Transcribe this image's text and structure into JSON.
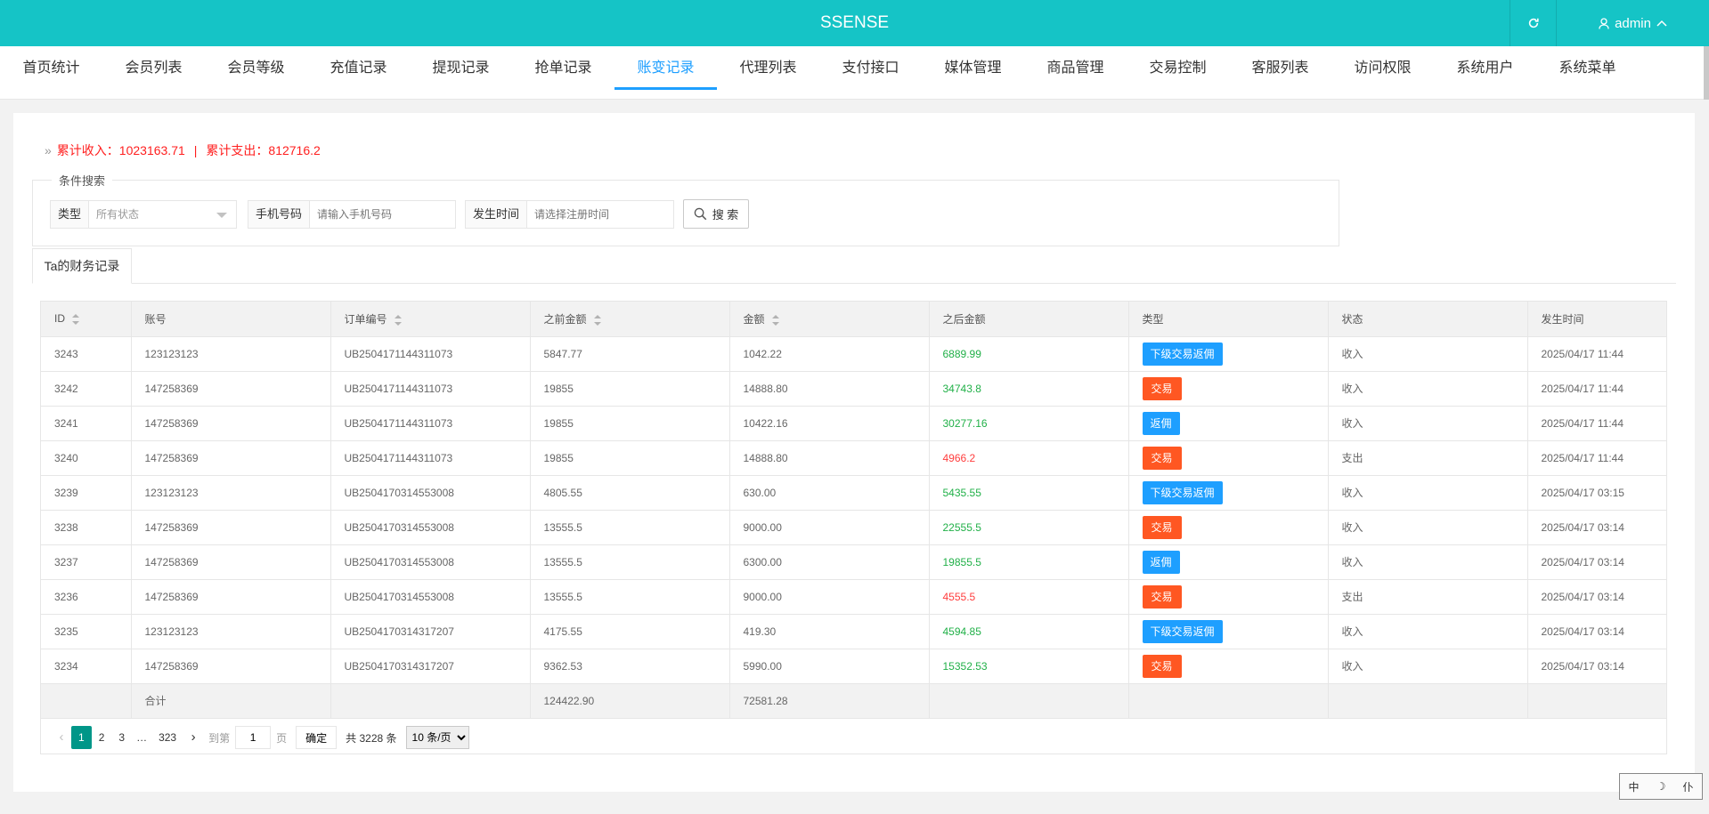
{
  "app": {
    "brand": "SSENSE",
    "user": "admin"
  },
  "nav": {
    "items": [
      "首页统计",
      "会员列表",
      "会员等级",
      "充值记录",
      "提现记录",
      "抢单记录",
      "账变记录",
      "代理列表",
      "支付接口",
      "媒体管理",
      "商品管理",
      "交易控制",
      "客服列表",
      "访问权限",
      "系统用户",
      "系统菜单"
    ],
    "active": "账变记录"
  },
  "summary": {
    "income": "累计收入：1023163.71",
    "separator": "|",
    "expense": "累计支出：812716.2"
  },
  "search": {
    "legend": "条件搜索",
    "type_label": "类型",
    "type_value": "所有状态",
    "phone_label": "手机号码",
    "phone_placeholder": "请输入手机号码",
    "time_label": "发生时间",
    "time_placeholder": "请选择注册时间",
    "button": "搜 索"
  },
  "tab": {
    "label": "Ta的财务记录"
  },
  "table": {
    "headers": [
      "ID",
      "账号",
      "订单编号",
      "之前金额",
      "金额",
      "之后金额",
      "类型",
      "状态",
      "发生时间"
    ],
    "rows": [
      {
        "id": "3243",
        "account": "123123123",
        "order": "UB2504171144311073",
        "before": "5847.77",
        "amount": "1042.22",
        "after": "6889.99",
        "after_color": "green",
        "type": "下级交易返佣",
        "type_color": "blue",
        "status": "收入",
        "time": "2025/04/17 11:44"
      },
      {
        "id": "3242",
        "account": "147258369",
        "order": "UB2504171144311073",
        "before": "19855",
        "amount": "14888.80",
        "after": "34743.8",
        "after_color": "green",
        "type": "交易",
        "type_color": "orange",
        "status": "收入",
        "time": "2025/04/17 11:44"
      },
      {
        "id": "3241",
        "account": "147258369",
        "order": "UB2504171144311073",
        "before": "19855",
        "amount": "10422.16",
        "after": "30277.16",
        "after_color": "green",
        "type": "返佣",
        "type_color": "blue",
        "status": "收入",
        "time": "2025/04/17 11:44"
      },
      {
        "id": "3240",
        "account": "147258369",
        "order": "UB2504171144311073",
        "before": "19855",
        "amount": "14888.80",
        "after": "4966.2",
        "after_color": "red",
        "type": "交易",
        "type_color": "orange",
        "status": "支出",
        "time": "2025/04/17 11:44"
      },
      {
        "id": "3239",
        "account": "123123123",
        "order": "UB2504170314553008",
        "before": "4805.55",
        "amount": "630.00",
        "after": "5435.55",
        "after_color": "green",
        "type": "下级交易返佣",
        "type_color": "blue",
        "status": "收入",
        "time": "2025/04/17 03:15"
      },
      {
        "id": "3238",
        "account": "147258369",
        "order": "UB2504170314553008",
        "before": "13555.5",
        "amount": "9000.00",
        "after": "22555.5",
        "after_color": "green",
        "type": "交易",
        "type_color": "orange",
        "status": "收入",
        "time": "2025/04/17 03:14"
      },
      {
        "id": "3237",
        "account": "147258369",
        "order": "UB2504170314553008",
        "before": "13555.5",
        "amount": "6300.00",
        "after": "19855.5",
        "after_color": "green",
        "type": "返佣",
        "type_color": "blue",
        "status": "收入",
        "time": "2025/04/17 03:14"
      },
      {
        "id": "3236",
        "account": "147258369",
        "order": "UB2504170314553008",
        "before": "13555.5",
        "amount": "9000.00",
        "after": "4555.5",
        "after_color": "red",
        "type": "交易",
        "type_color": "orange",
        "status": "支出",
        "time": "2025/04/17 03:14"
      },
      {
        "id": "3235",
        "account": "123123123",
        "order": "UB2504170314317207",
        "before": "4175.55",
        "amount": "419.30",
        "after": "4594.85",
        "after_color": "green",
        "type": "下级交易返佣",
        "type_color": "blue",
        "status": "收入",
        "time": "2025/04/17 03:14"
      },
      {
        "id": "3234",
        "account": "147258369",
        "order": "UB2504170314317207",
        "before": "9362.53",
        "amount": "5990.00",
        "after": "15352.53",
        "after_color": "green",
        "type": "交易",
        "type_color": "orange",
        "status": "收入",
        "time": "2025/04/17 03:14"
      }
    ],
    "total": {
      "label": "合计",
      "before": "124422.90",
      "amount": "72581.28"
    }
  },
  "pager": {
    "pages": [
      "1",
      "2",
      "3"
    ],
    "dots": "…",
    "last": "323",
    "goto_label": "到第",
    "goto_value": "1",
    "page_unit": "页",
    "confirm": "确定",
    "total": "共 3228 条",
    "limit": "10 条/页"
  },
  "ime": {
    "lang": "中",
    "mode": "☽",
    "punct": "仆"
  },
  "colors": {
    "topbar": "#15c4c6",
    "active_nav": "#1e9fff",
    "badge_blue": "#1e9fff",
    "badge_orange": "#ff5722",
    "income_green": "#21b048",
    "expense_red": "#ff3d3d",
    "pager_current": "#009688"
  }
}
